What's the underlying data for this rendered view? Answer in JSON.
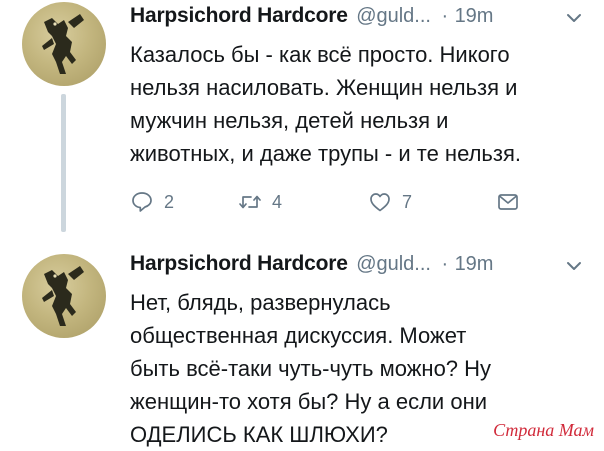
{
  "tweets": [
    {
      "name": "Harpsichord Hardcore",
      "handle": "@guld...",
      "separator": "·",
      "time": "19m",
      "lines": [
        "Казалось бы - как всё просто. Никого",
        "нельзя насиловать. Женщин нельзя и",
        "мужчин нельзя, детей нельзя и",
        "животных, и даже трупы - и те нельзя."
      ],
      "actions": {
        "reply_count": "2",
        "retweet_count": "4",
        "like_count": "7"
      }
    },
    {
      "name": "Harpsichord Hardcore",
      "handle": "@guld...",
      "separator": "·",
      "time": "19m",
      "lines": [
        "Нет, блядь, развернулась",
        "общественная дискуссия. Может",
        "быть всё-таки чуть-чуть можно? Ну",
        "женщин-то хотя бы? Ну а если они",
        "ОДЕЛИСЬ КАК ШЛЮХИ?"
      ]
    }
  ],
  "watermark": "Страна Мам",
  "colors": {
    "text": "#14171a",
    "muted": "#657786",
    "thread_line": "#ccd6dd",
    "watermark": "#d12b3b"
  },
  "icons": [
    "reply-icon",
    "retweet-icon",
    "like-icon",
    "direct-message-icon",
    "chevron-down-icon"
  ]
}
